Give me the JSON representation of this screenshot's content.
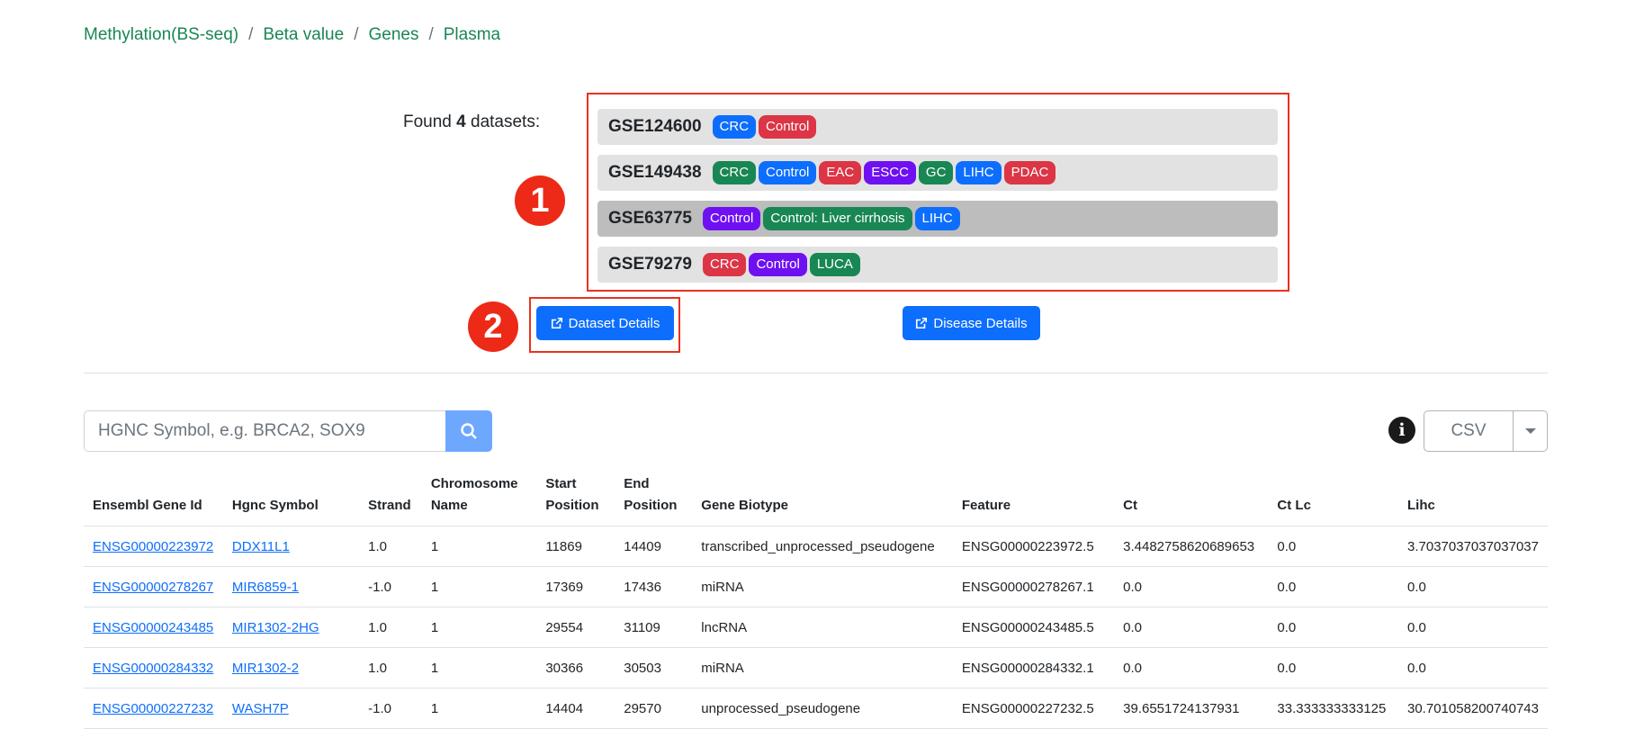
{
  "breadcrumb": [
    "Methylation(BS-seq)",
    "Beta value",
    "Genes",
    "Plasma"
  ],
  "found": {
    "prefix": "Found ",
    "count": "4",
    "suffix": " datasets:"
  },
  "annotations": {
    "one": "1",
    "two": "2"
  },
  "datasets": [
    {
      "name": "GSE124600",
      "badges": [
        {
          "label": "CRC",
          "color": "#0d6efd"
        },
        {
          "label": "Control",
          "color": "#dc3545"
        }
      ]
    },
    {
      "name": "GSE149438",
      "badges": [
        {
          "label": "CRC",
          "color": "#198754"
        },
        {
          "label": "Control",
          "color": "#0d6efd"
        },
        {
          "label": "EAC",
          "color": "#dc3545"
        },
        {
          "label": "ESCC",
          "color": "#6f10f2"
        },
        {
          "label": "GC",
          "color": "#198754"
        },
        {
          "label": "LIHC",
          "color": "#0d6efd"
        },
        {
          "label": "PDAC",
          "color": "#dc3545"
        }
      ]
    },
    {
      "name": "GSE63775",
      "badges": [
        {
          "label": "Control",
          "color": "#6f10f2"
        },
        {
          "label": "Control: Liver cirrhosis",
          "color": "#198754"
        },
        {
          "label": "LIHC",
          "color": "#0d6efd"
        }
      ]
    },
    {
      "name": "GSE79279",
      "badges": [
        {
          "label": "CRC",
          "color": "#dc3545"
        },
        {
          "label": "Control",
          "color": "#6f10f2"
        },
        {
          "label": "LUCA",
          "color": "#198754"
        }
      ]
    }
  ],
  "buttons": {
    "dataset_details": "Dataset Details",
    "disease_details": "Disease Details"
  },
  "search": {
    "placeholder": "HGNC Symbol, e.g. BRCA2, SOX9"
  },
  "export": {
    "format": "CSV"
  },
  "info_icon": "i",
  "table": {
    "columns": [
      [
        "Ensembl Gene Id"
      ],
      [
        "Hgnc Symbol"
      ],
      [
        "Strand"
      ],
      [
        "Chromosome",
        "Name"
      ],
      [
        "Start",
        "Position"
      ],
      [
        "End",
        "Position"
      ],
      [
        "Gene Biotype"
      ],
      [
        "Feature"
      ],
      [
        "Ct"
      ],
      [
        "Ct Lc"
      ],
      [
        "Lihc"
      ]
    ],
    "rows": [
      [
        "ENSG00000223972",
        "DDX11L1",
        "1.0",
        "1",
        "11869",
        "14409",
        "transcribed_unprocessed_pseudogene",
        "ENSG00000223972.5",
        "3.4482758620689653",
        "0.0",
        "3.7037037037037037"
      ],
      [
        "ENSG00000278267",
        "MIR6859-1",
        "-1.0",
        "1",
        "17369",
        "17436",
        "miRNA",
        "ENSG00000278267.1",
        "0.0",
        "0.0",
        "0.0"
      ],
      [
        "ENSG00000243485",
        "MIR1302-2HG",
        "1.0",
        "1",
        "29554",
        "31109",
        "lncRNA",
        "ENSG00000243485.5",
        "0.0",
        "0.0",
        "0.0"
      ],
      [
        "ENSG00000284332",
        "MIR1302-2",
        "1.0",
        "1",
        "30366",
        "30503",
        "miRNA",
        "ENSG00000284332.1",
        "0.0",
        "0.0",
        "0.0"
      ],
      [
        "ENSG00000227232",
        "WASH7P",
        "-1.0",
        "1",
        "14404",
        "29570",
        "unprocessed_pseudogene",
        "ENSG00000227232.5",
        "39.6551724137931",
        "33.333333333125",
        "30.701058200740743"
      ]
    ]
  }
}
